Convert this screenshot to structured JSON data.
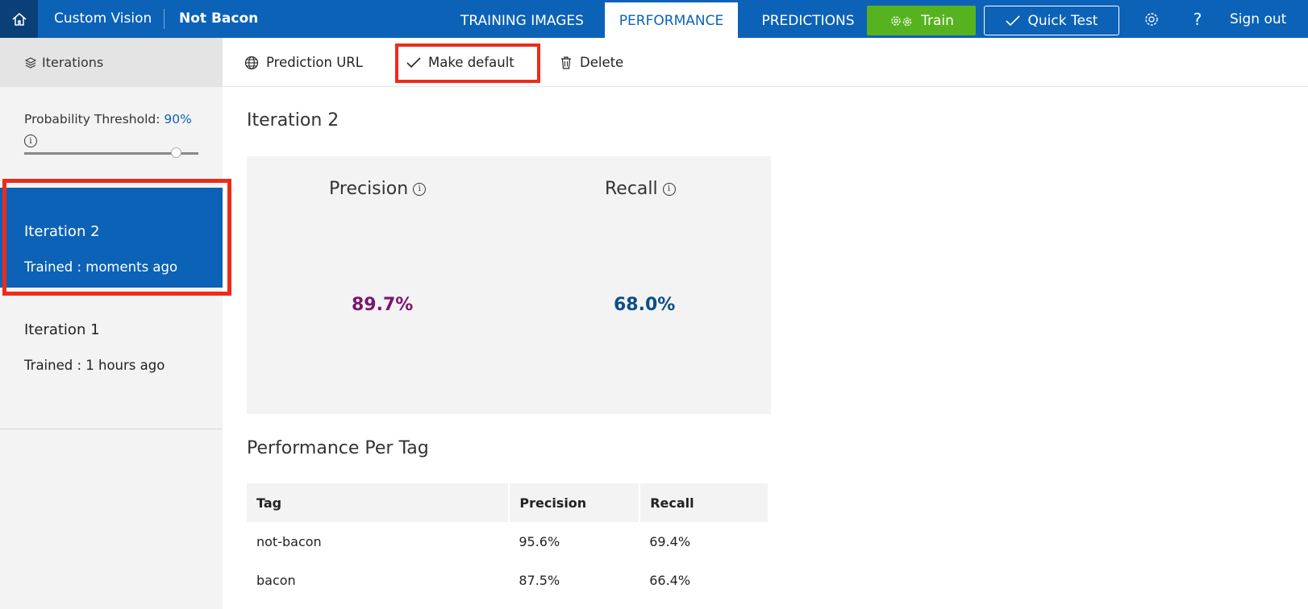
{
  "header": {
    "app_title": "Custom Vision",
    "project_title": "Not Bacon",
    "tabs": [
      {
        "label": "TRAINING IMAGES",
        "active": false
      },
      {
        "label": "PERFORMANCE",
        "active": true
      },
      {
        "label": "PREDICTIONS",
        "active": false
      }
    ],
    "train_label": "Train",
    "quick_test_label": "Quick Test",
    "help_label": "?",
    "sign_out_label": "Sign out"
  },
  "sidebar": {
    "header_label": "Iterations",
    "threshold_label": "Probability Threshold:",
    "threshold_value": "90%",
    "threshold_fraction": 0.9,
    "iterations": [
      {
        "name": "Iteration 2",
        "trained": "Trained : moments ago",
        "selected": true
      },
      {
        "name": "Iteration 1",
        "trained": "Trained : 1 hours ago",
        "selected": false
      }
    ]
  },
  "toolbar": {
    "prediction_url_label": "Prediction URL",
    "make_default_label": "Make default",
    "delete_label": "Delete"
  },
  "main": {
    "iteration_title": "Iteration 2",
    "precision_label": "Precision",
    "recall_label": "Recall",
    "precision_value": "89.7%",
    "recall_value": "68.0%",
    "per_tag_title": "Performance Per Tag",
    "table": {
      "headers": [
        "Tag",
        "Precision",
        "Recall"
      ],
      "rows": [
        [
          "not-bacon",
          "95.6%",
          "69.4%"
        ],
        [
          "bacon",
          "87.5%",
          "66.4%"
        ]
      ]
    }
  },
  "colors": {
    "brand_blue": "#0c62b7",
    "train_green": "#57b21f",
    "highlight_red": "#ee2b1a",
    "precision_color": "#7a1570",
    "recall_color": "#0d4e86"
  },
  "icons": [
    "home-icon",
    "gear-icon",
    "checkmark-icon",
    "help-icon",
    "layers-icon",
    "info-icon",
    "globe-icon",
    "trash-icon"
  ]
}
